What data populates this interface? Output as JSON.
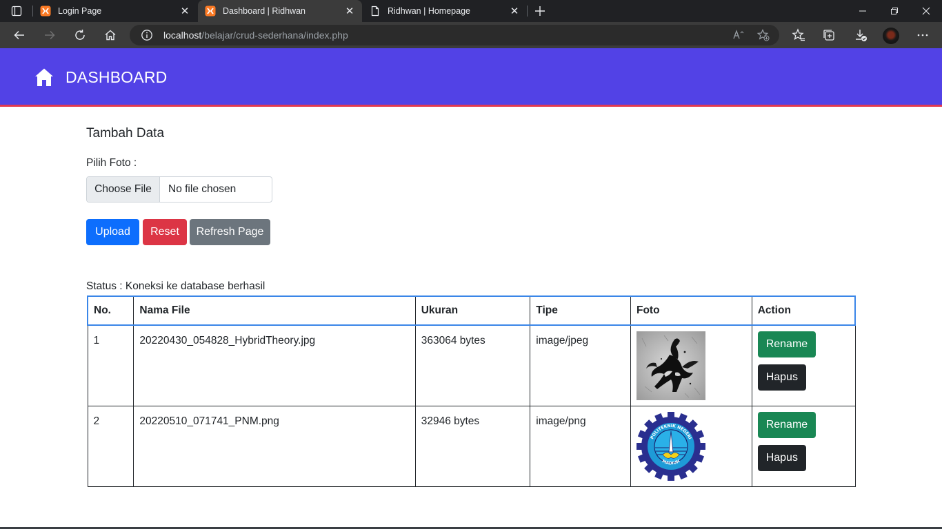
{
  "browser": {
    "tabs": [
      {
        "title": "Login Page",
        "active": false,
        "icon": "xampp-icon"
      },
      {
        "title": "Dashboard | Ridhwan",
        "active": true,
        "icon": "xampp-icon"
      },
      {
        "title": "Ridhwan | Homepage",
        "active": false,
        "icon": "page-icon"
      }
    ],
    "address": {
      "host": "localhost",
      "path": "/belajar/crud-sederhana/index.php"
    }
  },
  "header": {
    "title": "DASHBOARD",
    "icon": "home-icon",
    "color": "#5242e6",
    "accent": "#e33a4f"
  },
  "form": {
    "section_title": "Tambah Data",
    "pick_label": "Pilih Foto :",
    "choose_button": "Choose File",
    "file_status": "No file chosen",
    "buttons": {
      "upload": "Upload",
      "reset": "Reset",
      "refresh": "Refresh Page"
    }
  },
  "status": "Status : Koneksi ke database berhasil",
  "table": {
    "headers": [
      "No.",
      "Nama File",
      "Ukuran",
      "Tipe",
      "Foto",
      "Action"
    ],
    "rows": [
      {
        "no": "1",
        "name": "20220430_054828_HybridTheory.jpg",
        "size": "363064 bytes",
        "type": "image/jpeg",
        "photo": "hybrid-theory-soldier-image",
        "rename": "Rename",
        "delete": "Hapus"
      },
      {
        "no": "2",
        "name": "20220510_071741_PNM.png",
        "size": "32946 bytes",
        "type": "image/png",
        "photo": "pnm-logo-image",
        "rename": "Rename",
        "delete": "Hapus"
      }
    ]
  },
  "pnm_logo": {
    "top_text": "POLITEKNIK NEGERI",
    "bottom_text": "MADIUN"
  }
}
